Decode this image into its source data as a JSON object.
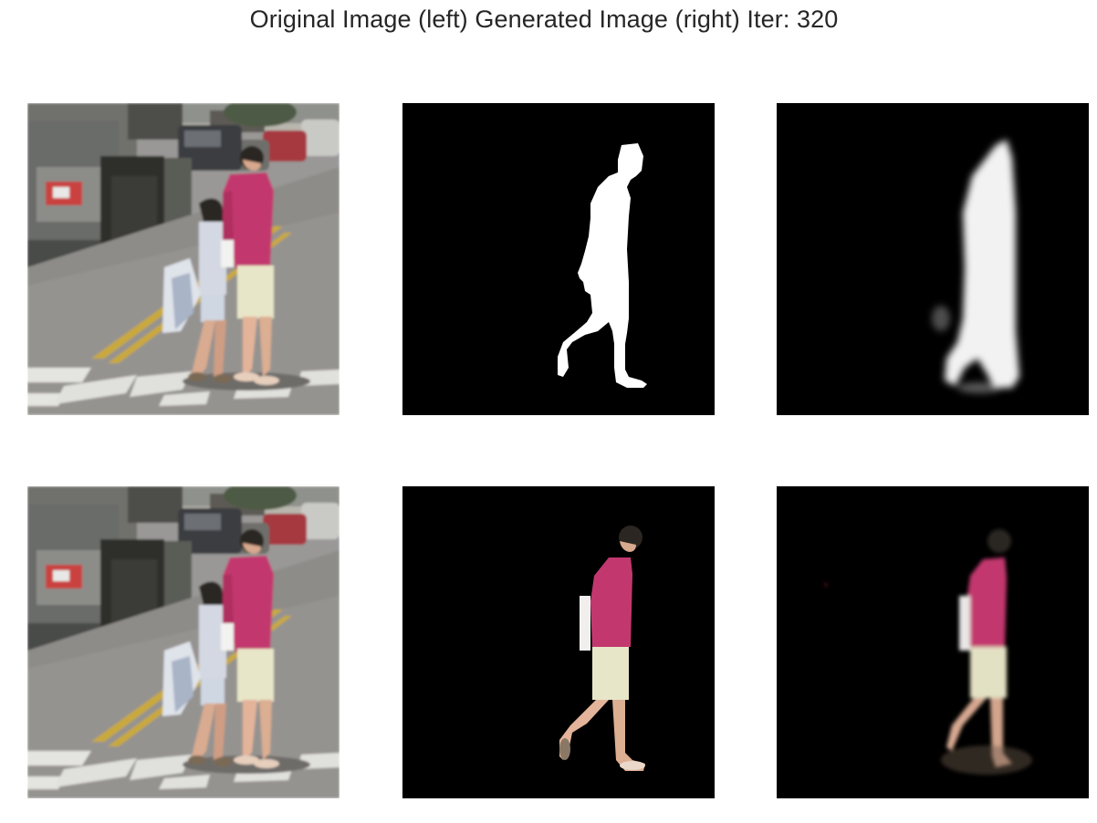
{
  "figure": {
    "suptitle": "Original Image (left) Generated Image (right) Iter: 320"
  },
  "panels": [
    {
      "row": 0,
      "col": 0,
      "content": "street photo"
    },
    {
      "row": 0,
      "col": 1,
      "content": "ground-truth mask"
    },
    {
      "row": 0,
      "col": 2,
      "content": "generated mask"
    },
    {
      "row": 1,
      "col": 0,
      "content": "street photo"
    },
    {
      "row": 1,
      "col": 1,
      "content": "ground-truth masked person"
    },
    {
      "row": 1,
      "col": 2,
      "content": "generated masked person"
    }
  ],
  "colors": {
    "shirt": "#c2386e",
    "shorts": "#e8e6c8",
    "skin": "#e3b49a",
    "hair": "#2b2622",
    "road": "#8d8b88"
  }
}
